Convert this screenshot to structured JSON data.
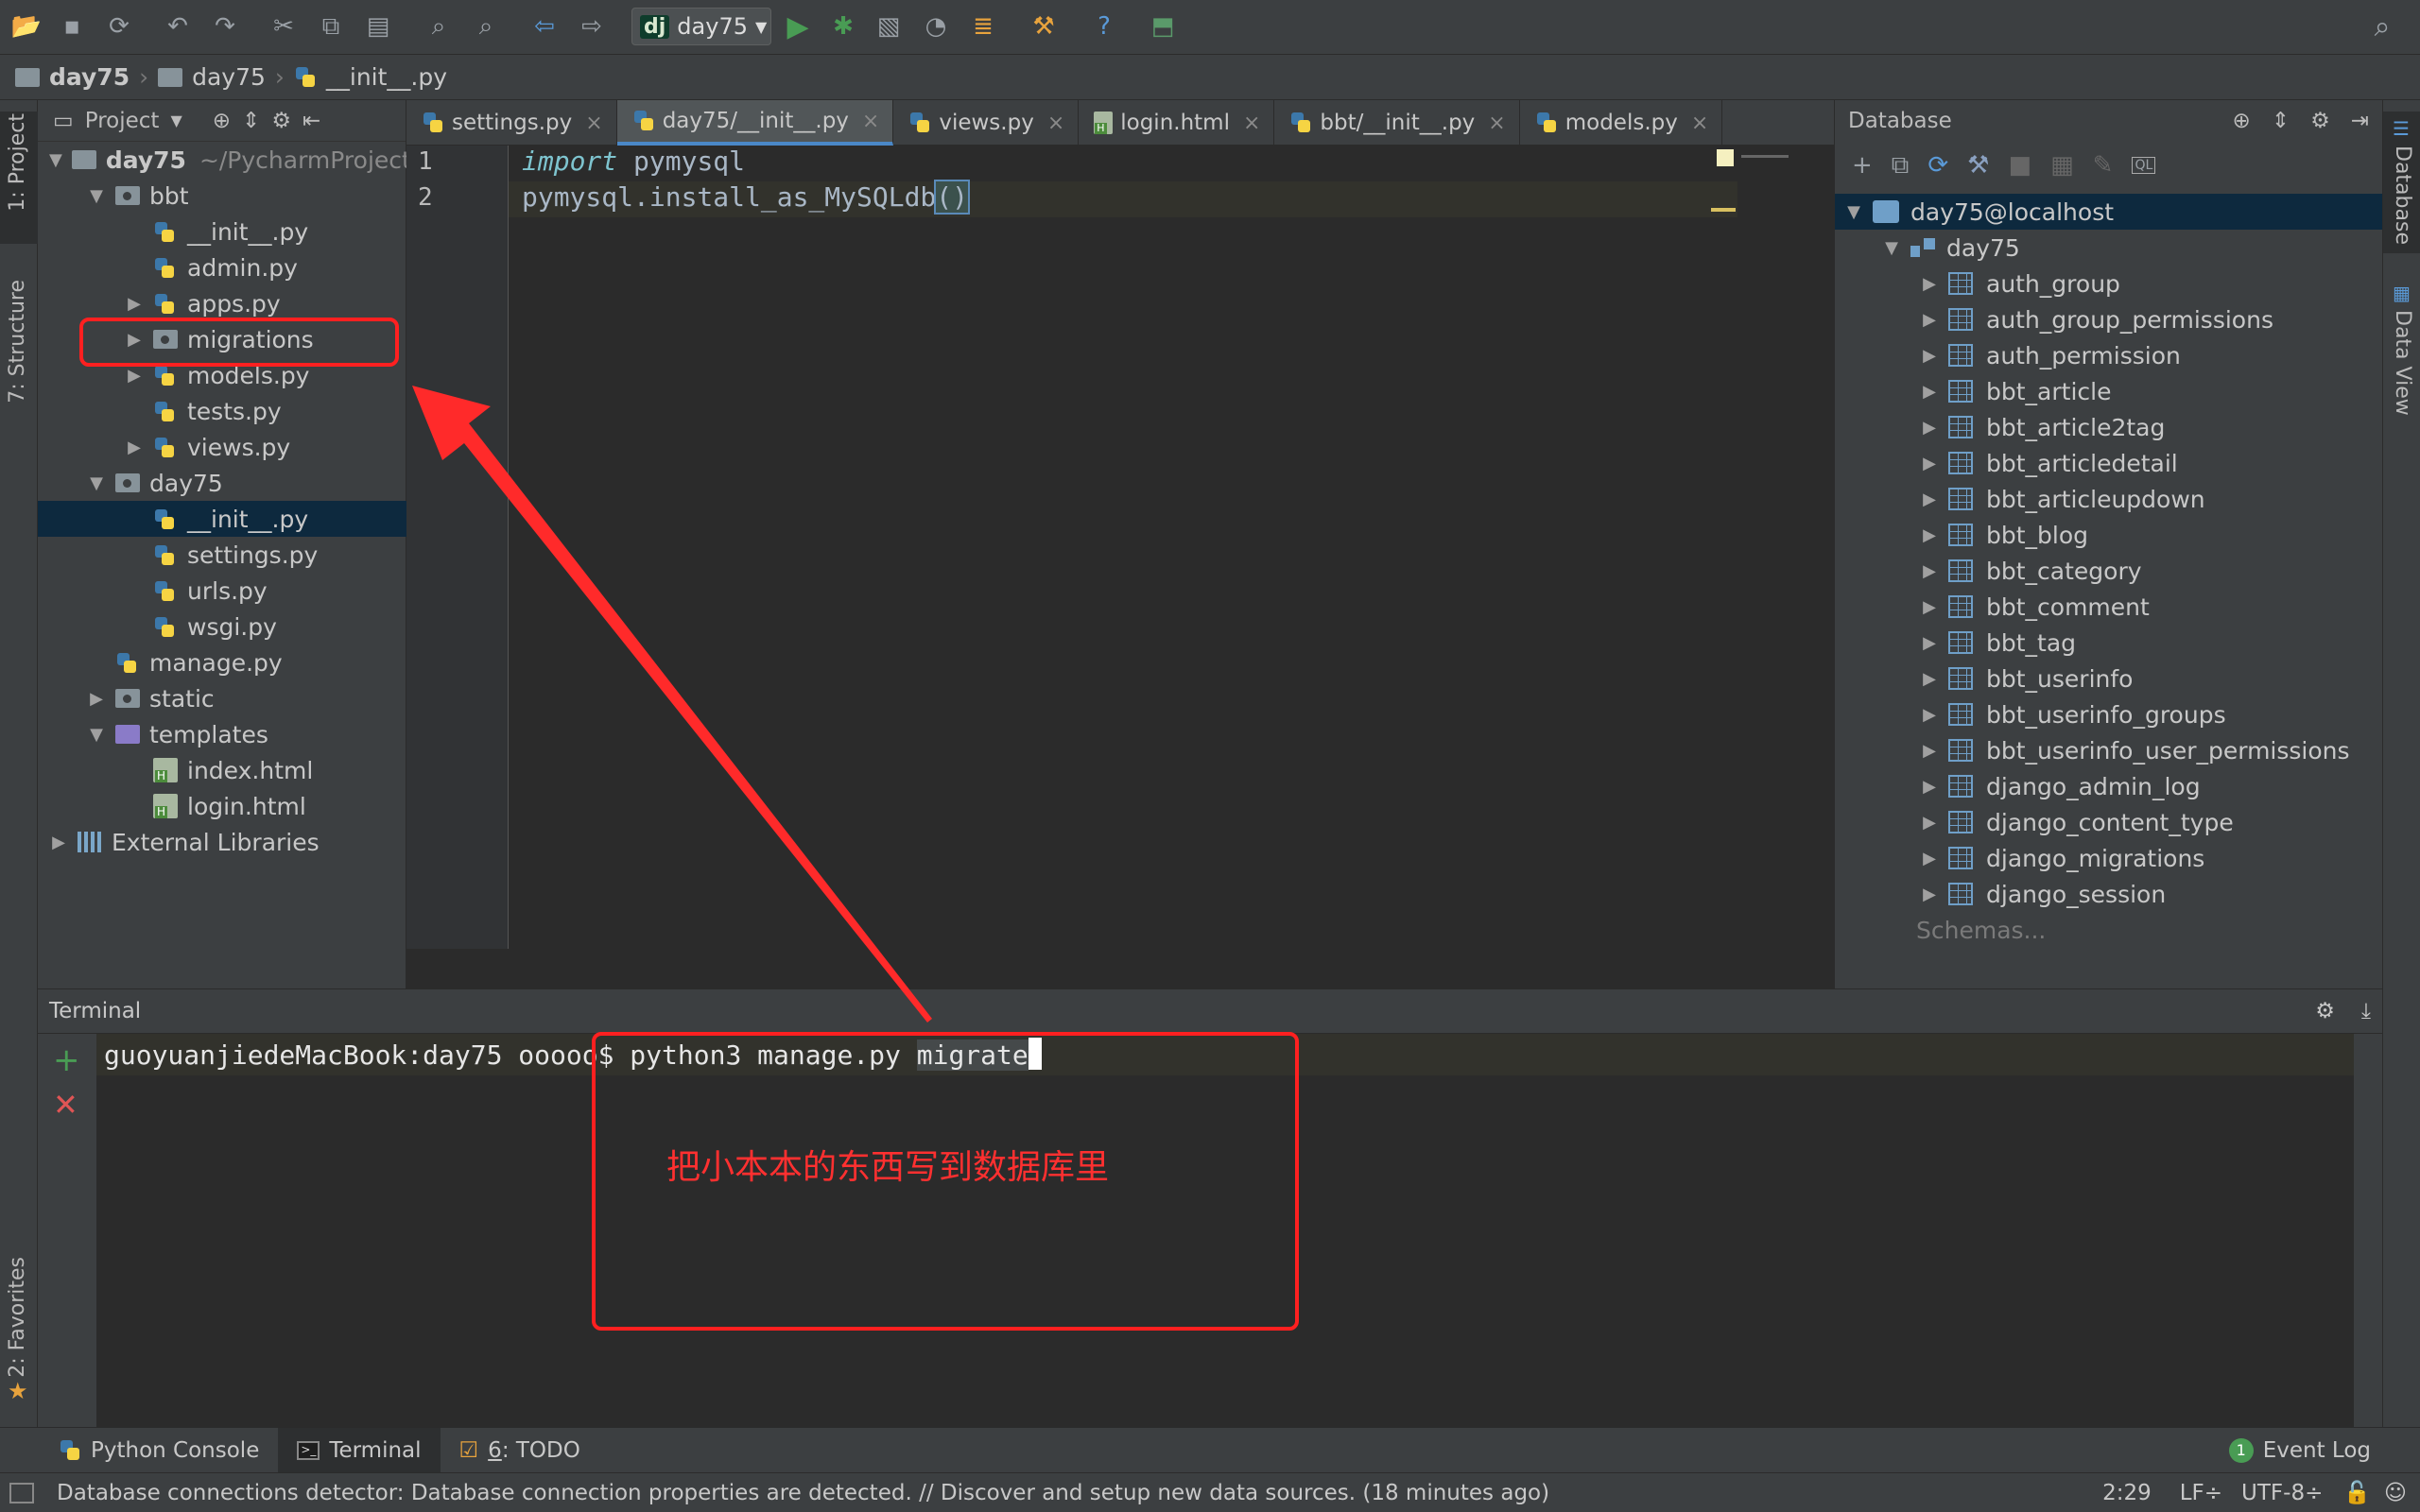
{
  "toolbar": {
    "run_config": "day75",
    "run_config_badge": "dj"
  },
  "breadcrumb": [
    "day75",
    "day75",
    "__init__.py"
  ],
  "left_strip": {
    "project_tab": "1: Project",
    "structure_tab": "7: Structure",
    "favorites_tab": "2: Favorites"
  },
  "right_strip": {
    "database_tab": "Database",
    "dataview_tab": "Data View"
  },
  "project": {
    "header": "Project",
    "root_name": "day75",
    "root_path": "~/PycharmProject",
    "items": [
      {
        "label": "bbt",
        "level": 1,
        "icon": "folder-package",
        "arrow": "▼"
      },
      {
        "label": "__init__.py",
        "level": 2,
        "icon": "python-file",
        "arrow": ""
      },
      {
        "label": "admin.py",
        "level": 2,
        "icon": "python-file",
        "arrow": ""
      },
      {
        "label": "apps.py",
        "level": 2,
        "icon": "python-file",
        "arrow": "▶"
      },
      {
        "label": "migrations",
        "level": 2,
        "icon": "folder-package",
        "arrow": "▶"
      },
      {
        "label": "models.py",
        "level": 2,
        "icon": "python-file",
        "arrow": "▶"
      },
      {
        "label": "tests.py",
        "level": 2,
        "icon": "python-file",
        "arrow": ""
      },
      {
        "label": "views.py",
        "level": 2,
        "icon": "python-file",
        "arrow": "▶"
      },
      {
        "label": "day75",
        "level": 1,
        "icon": "folder-package",
        "arrow": "▼"
      },
      {
        "label": "__init__.py",
        "level": 2,
        "icon": "python-file",
        "arrow": ""
      },
      {
        "label": "settings.py",
        "level": 2,
        "icon": "python-file",
        "arrow": ""
      },
      {
        "label": "urls.py",
        "level": 2,
        "icon": "python-file",
        "arrow": ""
      },
      {
        "label": "wsgi.py",
        "level": 2,
        "icon": "python-file",
        "arrow": ""
      },
      {
        "label": "manage.py",
        "level": 1,
        "icon": "python-file",
        "arrow": ""
      },
      {
        "label": "static",
        "level": 1,
        "icon": "folder",
        "arrow": "▶"
      },
      {
        "label": "templates",
        "level": 1,
        "icon": "folder-templates",
        "arrow": "▼"
      },
      {
        "label": "index.html",
        "level": 2,
        "icon": "html-file",
        "arrow": ""
      },
      {
        "label": "login.html",
        "level": 2,
        "icon": "html-file",
        "arrow": ""
      },
      {
        "label": "External Libraries",
        "level": 0,
        "icon": "library",
        "arrow": "▶"
      }
    ]
  },
  "editor": {
    "tabs": [
      {
        "label": "settings.py",
        "icon": "python-file",
        "close": "×"
      },
      {
        "label": "day75/__init__.py",
        "icon": "python-file",
        "close": "×"
      },
      {
        "label": "views.py",
        "icon": "python-file",
        "close": "×"
      },
      {
        "label": "login.html",
        "icon": "html-file",
        "close": "×"
      },
      {
        "label": "bbt/__init__.py",
        "icon": "python-file",
        "close": "×"
      },
      {
        "label": "models.py",
        "icon": "python-file",
        "close": "×"
      }
    ],
    "line_numbers": [
      "1",
      "2"
    ],
    "code": {
      "line1_keyword": "import",
      "line1_rest": " pymysql",
      "line2_main": "pymysql.install_as_MySQLdb",
      "line2_parens": "()"
    }
  },
  "database": {
    "header": "Database",
    "connection": "day75@localhost",
    "schema": "day75",
    "tables": [
      "auth_group",
      "auth_group_permissions",
      "auth_permission",
      "bbt_article",
      "bbt_article2tag",
      "bbt_articledetail",
      "bbt_articleupdown",
      "bbt_blog",
      "bbt_category",
      "bbt_comment",
      "bbt_tag",
      "bbt_userinfo",
      "bbt_userinfo_groups",
      "bbt_userinfo_user_permissions",
      "django_admin_log",
      "django_content_type",
      "django_migrations",
      "django_session"
    ],
    "schemas_link": "Schemas..."
  },
  "terminal": {
    "title": "Terminal",
    "prompt": "guoyuanjiedeMacBook:day75 ooooo$ ",
    "command": "python3 manage.py ",
    "command_selected": "migrate"
  },
  "annotation": {
    "text": "把小本本的东西写到数据库里",
    "color": "#ff2020"
  },
  "bottom_tabs": {
    "python_console": "Python Console",
    "terminal": "Terminal",
    "todo_number": "6",
    "todo_label": ": TODO",
    "event_log_badge": "1",
    "event_log": "Event Log"
  },
  "status_bar": {
    "message": "Database connections detector: Database connection properties are detected. // Discover and setup new data sources. (18 minutes ago)",
    "position": "2:29",
    "line_sep": "LF÷",
    "encoding": "UTF-8÷"
  },
  "colors": {
    "accent": "#4a88c7",
    "selection": "#0d293e",
    "run_green": "#499c54",
    "close_red": "#e05555"
  }
}
